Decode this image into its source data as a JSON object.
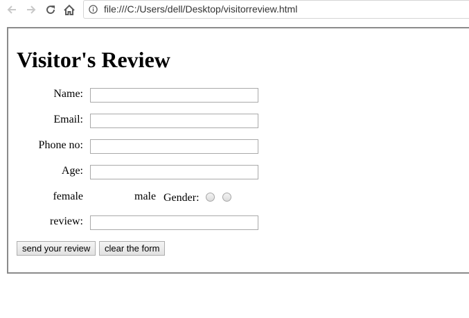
{
  "browser": {
    "url": "file:///C:/Users/dell/Desktop/visitorreview.html",
    "icons": {
      "back": "arrow-left-icon",
      "forward": "arrow-right-icon",
      "reload": "reload-icon",
      "home": "home-icon",
      "info": "info-icon"
    }
  },
  "page": {
    "title": "Visitor's Review",
    "form": {
      "name_label": "Name:",
      "name_value": "",
      "email_label": "Email:",
      "email_value": "",
      "phone_label": "Phone no:",
      "phone_value": "",
      "age_label": "Age:",
      "age_value": "",
      "female_label": "female",
      "male_label": "male",
      "gender_label": "Gender:",
      "review_label": "review:",
      "review_value": "",
      "submit_label": "send your review",
      "reset_label": "clear the form"
    }
  }
}
